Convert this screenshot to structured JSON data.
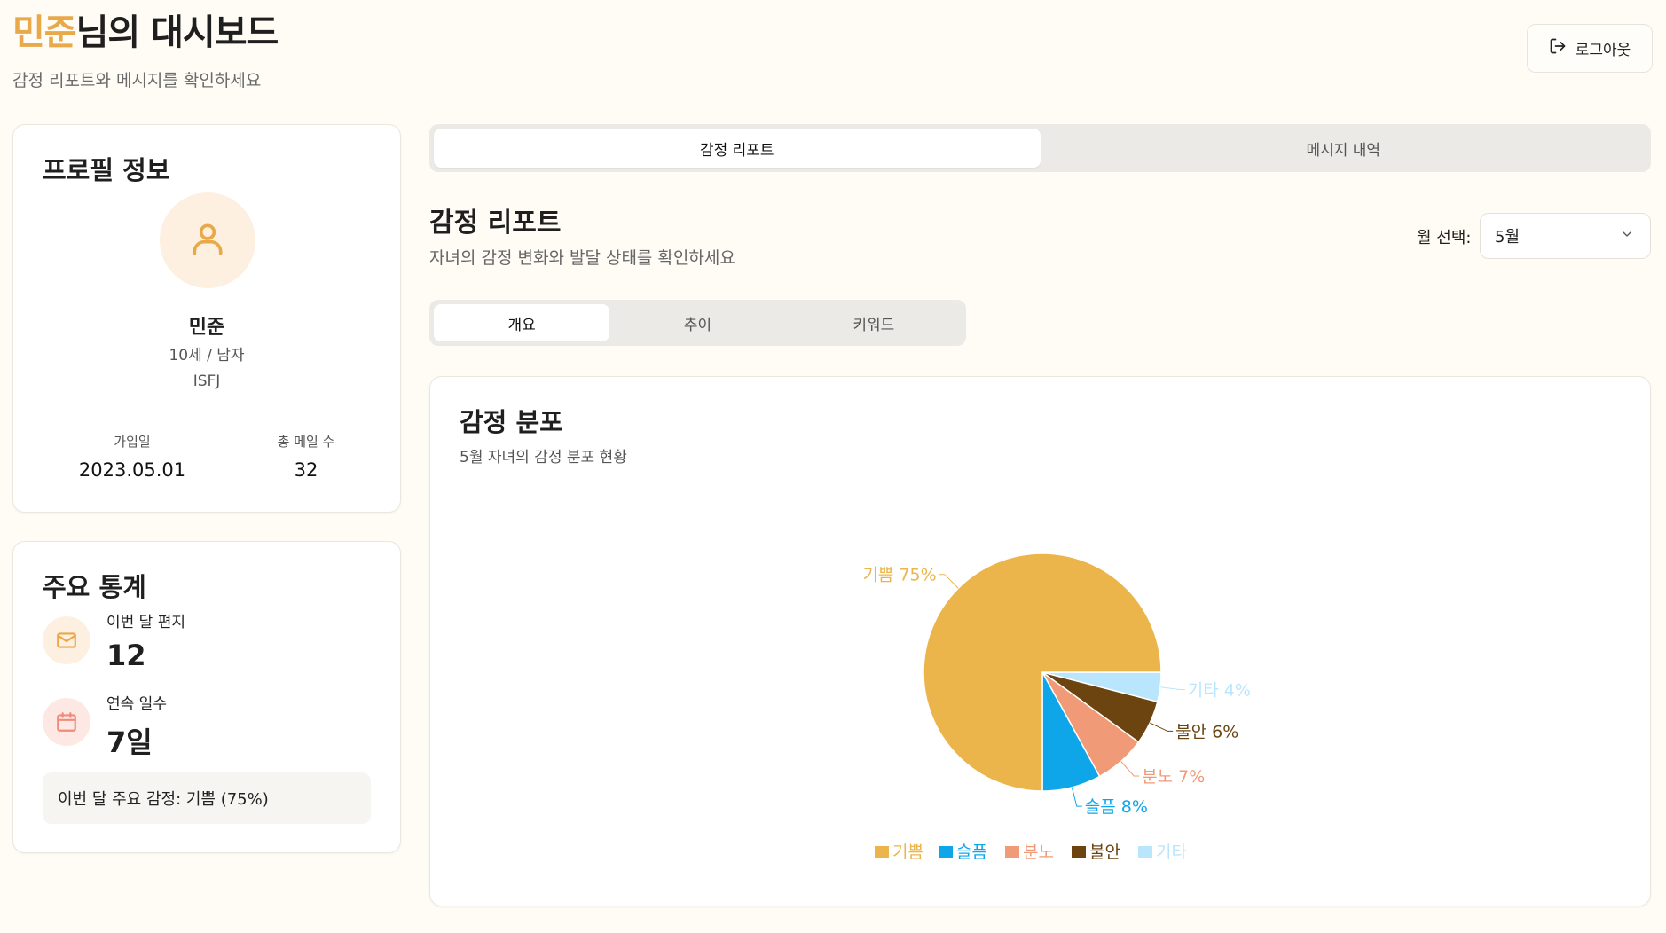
{
  "header": {
    "name": "민준",
    "title_suffix": "님의 대시보드",
    "subtitle": "감정 리포트와 메시지를 확인하세요",
    "logout_label": "로그아웃"
  },
  "profile": {
    "title": "프로필 정보",
    "name": "민준",
    "age_gender": "10세 / 남자",
    "mbti": "ISFJ",
    "joined_label": "가입일",
    "joined_value": "2023.05.01",
    "mail_label": "총 메일 수",
    "mail_value": "32"
  },
  "stats": {
    "title": "주요 통계",
    "letters_label": "이번 달 편지",
    "letters_value": "12",
    "streak_label": "연속 일수",
    "streak_value": "7일",
    "main_emotion": "이번 달 주요 감정: 기쁨 (75%)"
  },
  "tabs": {
    "report": "감정 리포트",
    "messages": "메시지 내역"
  },
  "report": {
    "title": "감정 리포트",
    "subtitle": "자녀의 감정 변화와 발달 상태를 확인하세요",
    "month_label": "월 선택:",
    "month_value": "5월"
  },
  "subtabs": {
    "overview": "개요",
    "trend": "추이",
    "keyword": "키워드"
  },
  "chart_card": {
    "title": "감정 분포",
    "subtitle": "5월 자녀의 감정 분포 현황"
  },
  "colors": {
    "accent": "#e8a94a"
  },
  "chart_data": {
    "type": "pie",
    "title": "감정 분포",
    "categories": [
      "기쁨",
      "슬픔",
      "분노",
      "불안",
      "기타"
    ],
    "values": [
      75,
      8,
      7,
      6,
      4
    ],
    "labels": [
      "기쁨 75%",
      "슬픔 8%",
      "분노 7%",
      "불안 6%",
      "기타 4%"
    ],
    "colors": [
      "#ebb54c",
      "#0ea5e9",
      "#f19a78",
      "#6b4410",
      "#bae6fd"
    ],
    "legend": "bottom"
  }
}
